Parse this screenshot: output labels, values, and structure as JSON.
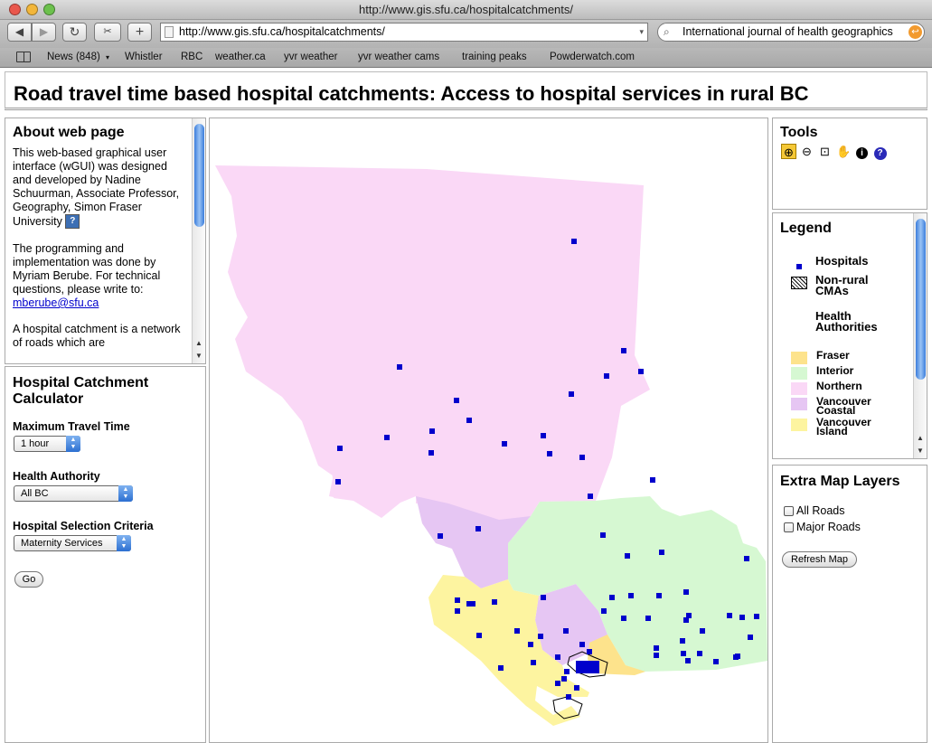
{
  "window": {
    "title": "http://www.gis.sfu.ca/hospitalcatchments/",
    "url": "http://www.gis.sfu.ca/hospitalcatchments/",
    "search": "International journal of health geographics"
  },
  "bookmarks": [
    "News (848)",
    "Whistler",
    "RBC",
    "weather.ca",
    "yvr weather",
    "yvr weather cams",
    "training peaks",
    "Powderwatch.com"
  ],
  "page": {
    "title": "Road travel time based hospital catchments: Access to hospital services in rural BC"
  },
  "about": {
    "heading": "About web page",
    "p1": "This web-based graphical user interface (wGUI) was designed and developed by Nadine Schuurman, Associate Professor, Geography, Simon Fraser University",
    "p2": "The programming and implementation was done by Myriam Berube. For technical questions, please write to:",
    "email": "mberube@sfu.ca",
    "p3": "A hospital catchment is a network of roads which are"
  },
  "calculator": {
    "heading": "Hospital Catchment Calculator",
    "travel_label": "Maximum Travel Time",
    "travel_value": "1 hour",
    "authority_label": "Health Authority",
    "authority_value": "All BC",
    "criteria_label": "Hospital Selection Criteria",
    "criteria_value": "Maternity Services",
    "go_label": "Go"
  },
  "tools": {
    "heading": "Tools",
    "items": [
      "zoom-in-icon",
      "zoom-out-icon",
      "zoom-extent-icon",
      "pan-hand-icon",
      "info-icon",
      "help-icon"
    ]
  },
  "legend": {
    "heading": "Legend",
    "hospitals": "Hospitals",
    "non_rural": "Non-rural CMAs",
    "health_authorities": "Health Authorities",
    "authorities": [
      {
        "name": "Fraser",
        "color": "#fde38c"
      },
      {
        "name": "Interior",
        "color": "#d6f8d2"
      },
      {
        "name": "Northern",
        "color": "#fad8f6"
      },
      {
        "name": "Vancouver Coastal",
        "color": "#e6c6f3"
      },
      {
        "name": "Vancouver Island",
        "color": "#fdf4a0"
      }
    ],
    "hospital_color": "#0000cc"
  },
  "layers": {
    "heading": "Extra Map Layers",
    "all_roads": "All Roads",
    "major_roads": "Major Roads",
    "refresh": "Refresh Map"
  }
}
